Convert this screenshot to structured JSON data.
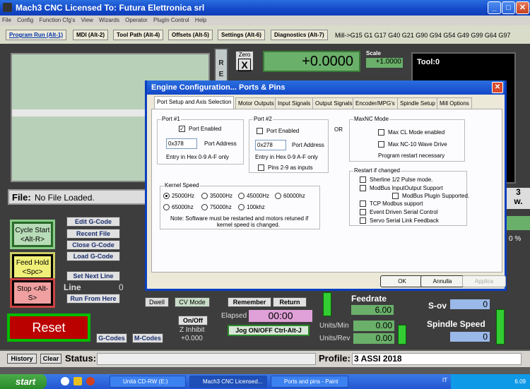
{
  "window": {
    "title": "Mach3 CNC  Licensed To:  Futura Elettronica srl"
  },
  "menu": [
    "File",
    "Config",
    "Function Cfg's",
    "View",
    "Wizards",
    "Operator",
    "PlugIn Control",
    "Help"
  ],
  "tabs": [
    "Program Run (Alt-1)",
    "MDI (Alt-2)",
    "Tool Path (Alt-4)",
    "Offsets (Alt-5)",
    "Settings (Alt-6)",
    "Diagnostics (Alt-7)"
  ],
  "gcodes": "Mill->G15  G1 G17 G40 G21 G90 G94 G54 G49 G99 G64 G97",
  "ref_label": "REF",
  "axis": {
    "zero_label": "Zero",
    "axis_letter": "X",
    "value": "+0.0000",
    "scale_label": "Scale",
    "scale_value": "+1.0000"
  },
  "tool_label": "Tool:0",
  "file": {
    "label": "File:",
    "name": "No File Loaded."
  },
  "buttons": {
    "cycle_start": "Cycle Start <Alt-R>",
    "feed_hold": "Feed Hold <Spc>",
    "stop": "Stop <Alt-S>",
    "edit_gcode": "Edit G-Code",
    "recent_file": "Recent File",
    "close_gcode": "Close G-Code",
    "load_gcode": "Load G-Code",
    "set_next_line": "Set Next Line",
    "run_from_here": "Run From Here",
    "reset": "Reset",
    "gcodes": "G-Codes",
    "mcodes": "M-Codes",
    "dwell": "Dwell",
    "cv_mode": "CV Mode",
    "on_off": "On/Off",
    "remember": "Remember",
    "return": "Return",
    "jog": "Jog ON/OFF Ctrl-Alt-J",
    "history": "History",
    "clear": "Clear"
  },
  "line": {
    "label": "Line",
    "value": "0"
  },
  "z_inhibit": {
    "label": "Z Inhibit",
    "value": "+0.000"
  },
  "elapsed": {
    "label": "Elapsed",
    "value": "00:00"
  },
  "feed": {
    "label": "Feedrate",
    "value": "6.00",
    "units_min_label": "Units/Min",
    "units_min": "0.00",
    "units_rev_label": "Units/Rev",
    "units_rev": "0.00"
  },
  "spindle": {
    "sov_label": "S-ov",
    "sov": "0",
    "speed_label": "Spindle Speed",
    "speed": "0"
  },
  "right_partial": {
    "a": "3",
    "b": "w.",
    "c": "0 %"
  },
  "status": {
    "label": "Status:",
    "profile_label": "Profile:",
    "profile": "3 ASSI 2018"
  },
  "taskbar": {
    "start": "start",
    "tasks": [
      "Unità CD-RW (E:)",
      "Mach3 CNC  Licensed...",
      "Ports and pins - Paint"
    ],
    "lang": "IT",
    "clock": "6.09"
  },
  "dialog": {
    "title": "Engine Configuration... Ports & Pins",
    "tabs": [
      "Port Setup and Axis Selection",
      "Motor Outputs",
      "Input Signals",
      "Output Signals",
      "Encoder/MPG's",
      "Spindle Setup",
      "Mill Options"
    ],
    "port1": {
      "label": "Port #1",
      "enabled_label": "Port Enabled",
      "address": "0x378",
      "address_label": "Port Address",
      "hint": "Entry in Hex 0-9 A-F only"
    },
    "port2": {
      "label": "Port #2",
      "enabled_label": "Port Enabled",
      "address": "0x278",
      "address_label": "Port Address",
      "hint": "Entry in Hex 0-9 A-F only",
      "pins_label": "Pins 2-9 as inputs"
    },
    "or_label": "OR",
    "maxnc": {
      "label": "MaxNC Mode",
      "opt1": "Max CL Mode enabled",
      "opt2": "Max NC-10 Wave Drive",
      "note": "Program restart necessary"
    },
    "kernel": {
      "label": "Kernel Speed",
      "speeds": [
        "25000Hz",
        "35000Hz",
        "45000Hz",
        "60000hz",
        "65000hz",
        "75000hz",
        "100khz"
      ],
      "note1": "Note: Software must be restarted and motors retuned if",
      "note2": "kernel speed is changed."
    },
    "restart": {
      "label": "Restart if changed",
      "items": [
        "Sherline 1/2 Pulse mode.",
        "ModBus InputOutput Support",
        "ModBus Plugin Supported.",
        "TCP Modbus support",
        "Event Driven Serial Control",
        "Servo Serial Link Feedback"
      ]
    },
    "ok": "OK",
    "cancel": "Annulla",
    "apply": "Applica"
  }
}
